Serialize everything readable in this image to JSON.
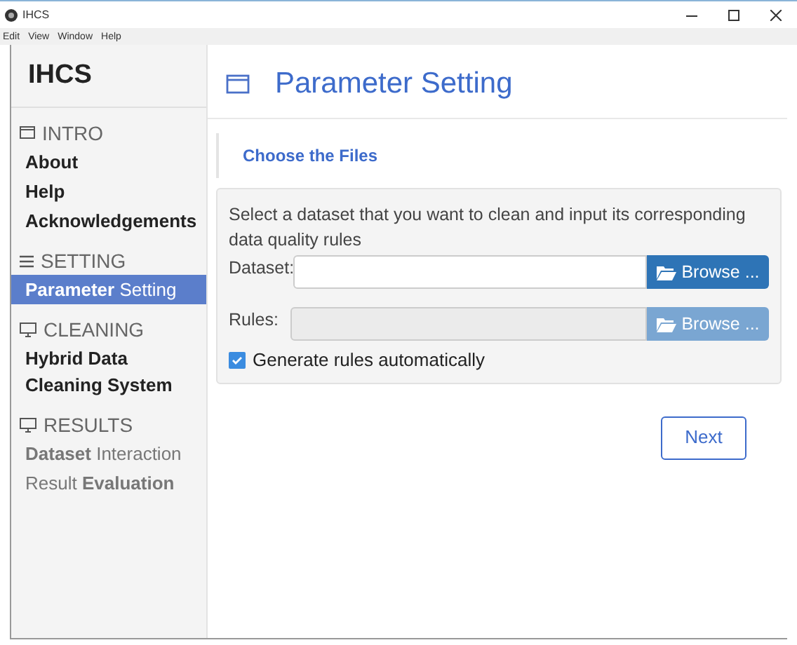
{
  "window": {
    "title": "IHCS"
  },
  "menu": [
    "Edit",
    "View",
    "Window",
    "Help"
  ],
  "sidebar": {
    "title": "IHCS",
    "sections": [
      {
        "label": "INTRO",
        "kind": "window",
        "items": [
          {
            "label": "About",
            "selected": false
          },
          {
            "label": "Help",
            "selected": false
          },
          {
            "label": "Acknowledgements",
            "selected": false
          }
        ]
      },
      {
        "label": "SETTING",
        "kind": "list",
        "items": [
          {
            "label": "**Parameter** Setting",
            "selected": true
          }
        ]
      },
      {
        "label": "CLEANING",
        "kind": "monitor",
        "items": [
          {
            "label": "Hybrid Data Cleaning System",
            "selected": false
          }
        ]
      },
      {
        "label": "RESULTS",
        "kind": "monitor",
        "items": [
          {
            "label": "**Dataset** Interaction",
            "selected": false
          },
          {
            "label": "Result **Evaluation**",
            "selected": false
          }
        ]
      }
    ]
  },
  "page": {
    "title": "Parameter Setting",
    "tab": "Choose the Files",
    "description": "Select a dataset that you want to clean and input its corresponding data quality rules",
    "fields": [
      {
        "label": "Dataset:",
        "button": "Browse ...",
        "disabled": false
      },
      {
        "label": "Rules:",
        "button": "Browse ...",
        "disabled": true
      }
    ],
    "checkbox": {
      "label": "Generate rules automatically",
      "checked": true
    },
    "next": "Next"
  }
}
